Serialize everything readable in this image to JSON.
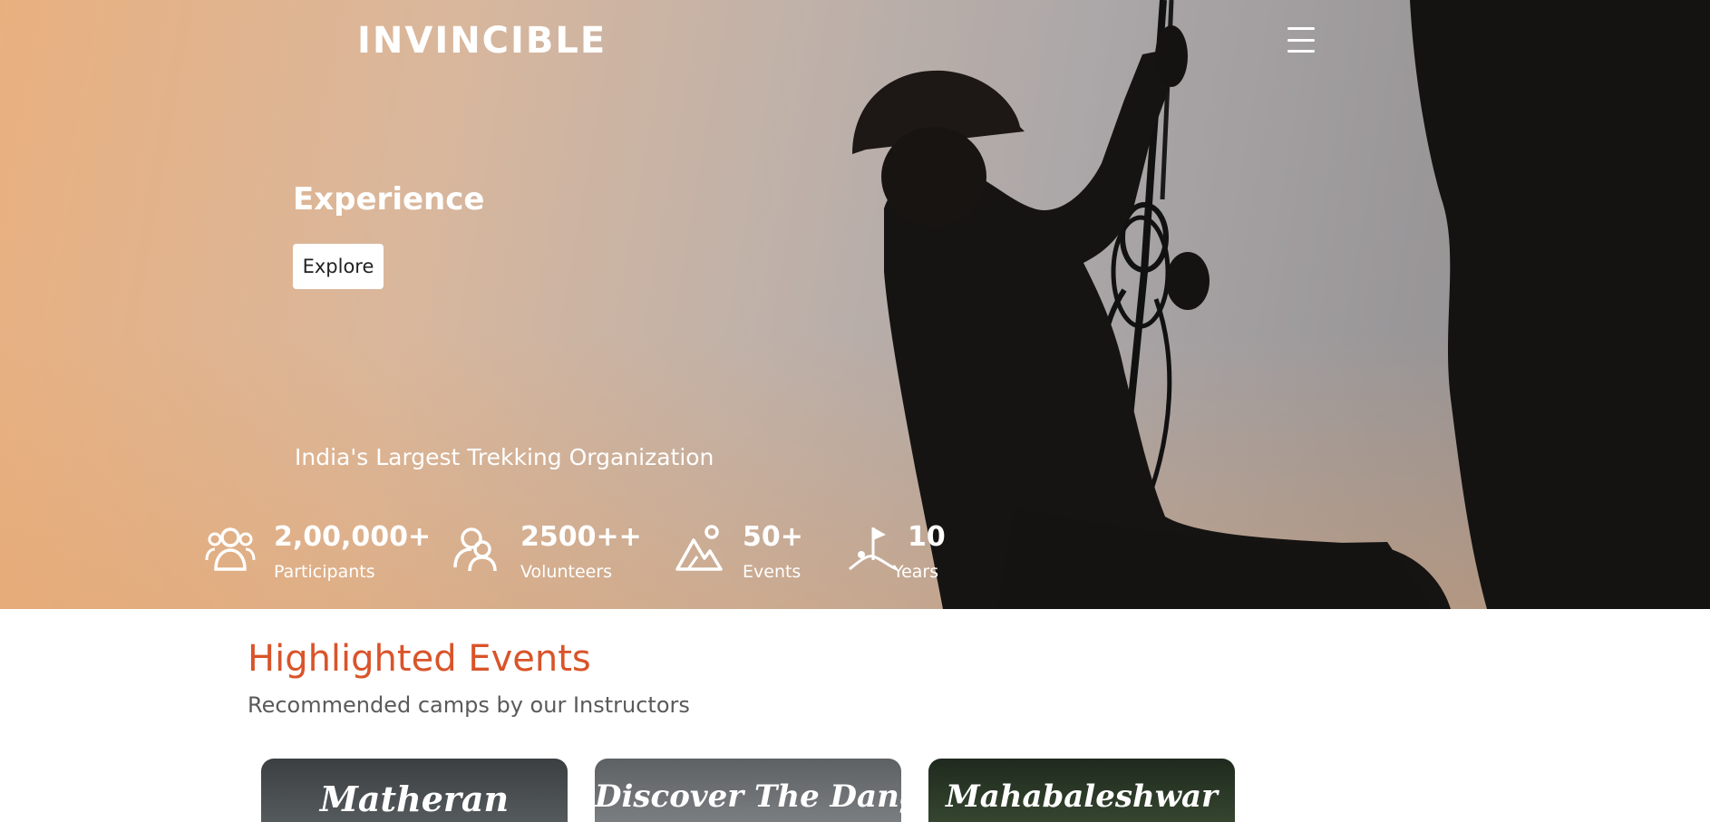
{
  "header": {
    "logo_text": "Invincible",
    "menu_icon": "hamburger-menu-icon"
  },
  "hero": {
    "title": "Experience",
    "cta_label": "Explore",
    "tagline": "India's Largest Trekking Organization"
  },
  "stats": [
    {
      "icon": "participants-icon",
      "value": "2,00,000+",
      "label": "Participants"
    },
    {
      "icon": "volunteers-icon",
      "value": "2500++",
      "label": "Volunteers"
    },
    {
      "icon": "mountain-events-icon",
      "value": "50+",
      "label": "Events"
    },
    {
      "icon": "flag-years-icon",
      "value": "10",
      "label": "Years"
    }
  ],
  "highlighted": {
    "title": "Highlighted Events",
    "subtitle": "Recommended camps by our Instructors",
    "cards": [
      {
        "title": "Matheran"
      },
      {
        "title": "Discover The Dangs"
      },
      {
        "title": "Mahabaleshwar"
      }
    ]
  },
  "colors": {
    "accent": "#d9542a",
    "subtitle_gray": "#5a5a5a",
    "hero_warm": "#e9b07f",
    "hero_cool": "#8e8b8e"
  }
}
